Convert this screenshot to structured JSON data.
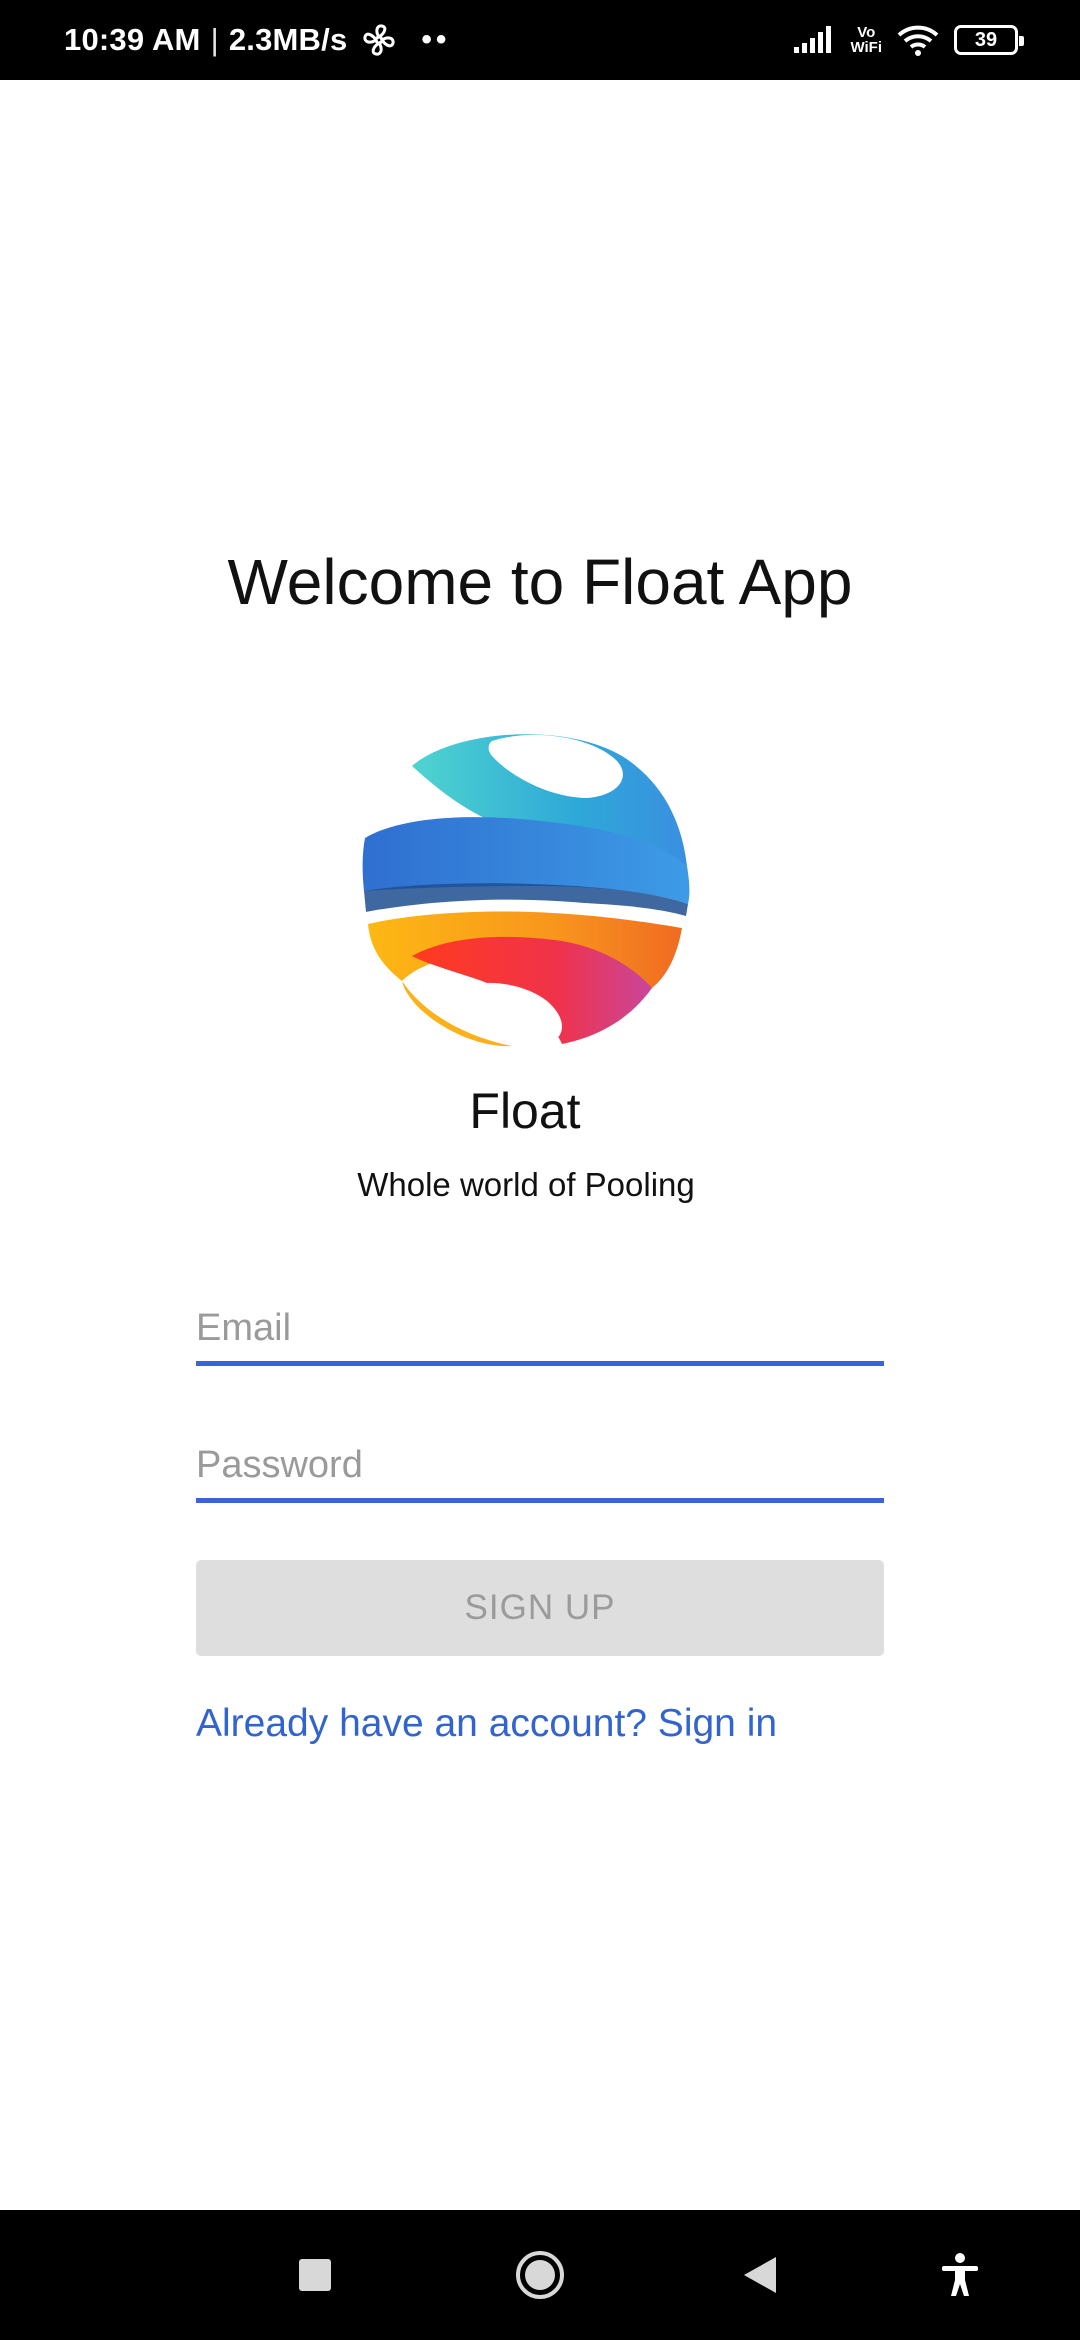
{
  "status_bar": {
    "time": "10:39 AM",
    "separator": "|",
    "speed": "2.3MB/s",
    "vowifi_top": "Vo",
    "vowifi_bottom": "WiFi",
    "battery": "39",
    "icons": [
      "fan-icon",
      "more-dots-icon",
      "signal-icon",
      "vowifi-icon",
      "wifi-icon",
      "battery-icon"
    ]
  },
  "main": {
    "welcome_title": "Welcome to Float App",
    "app_name": "Float",
    "tagline": "Whole world of Pooling",
    "email_placeholder": "Email",
    "password_placeholder": "Password",
    "signup_label": "SIGN UP",
    "signin_link": "Already have an account? Sign in"
  },
  "nav_bar": {
    "icons": [
      "recents-square-icon",
      "home-circle-icon",
      "back-triangle-icon",
      "accessibility-icon"
    ]
  },
  "colors": {
    "accent": "#3a63d9",
    "link": "#3264d0",
    "button_bg": "#dedede",
    "button_text": "#9b9b9b"
  }
}
